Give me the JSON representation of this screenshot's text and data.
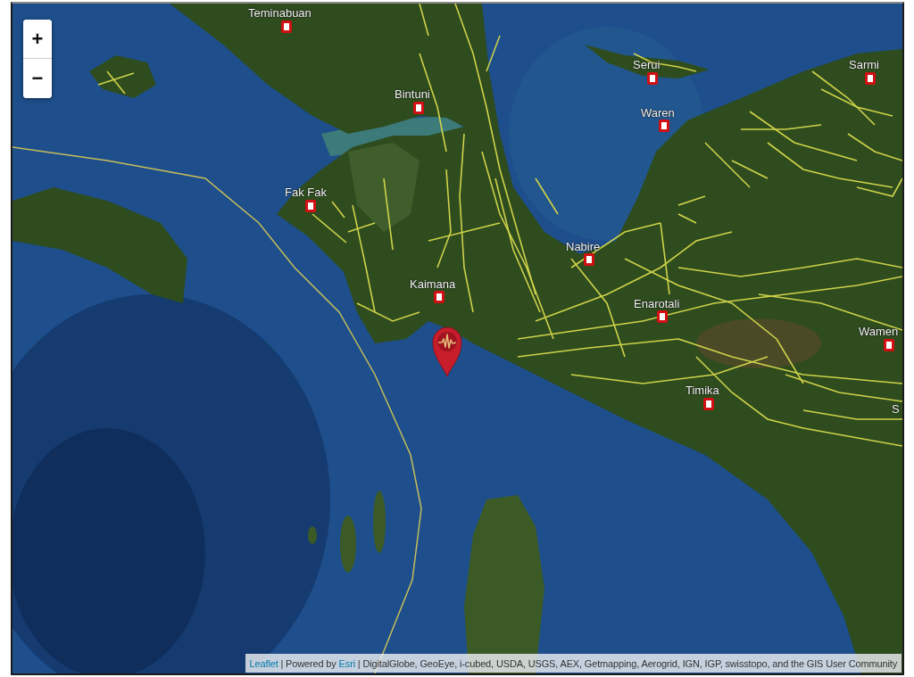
{
  "map": {
    "zoom_control": {
      "zoom_in": "+",
      "zoom_out": "−"
    },
    "cities": [
      {
        "name": "Teminabuan"
      },
      {
        "name": "Serui"
      },
      {
        "name": "Sarmi"
      },
      {
        "name": "Bintuni"
      },
      {
        "name": "Waren"
      },
      {
        "name": "Fak Fak"
      },
      {
        "name": "Nabire"
      },
      {
        "name": "Kaimana"
      },
      {
        "name": "Enarotali"
      },
      {
        "name": "Wamen"
      },
      {
        "name": "Timika"
      },
      {
        "name": "S"
      }
    ],
    "attribution": [
      {
        "kind": "link",
        "text": "Leaflet"
      },
      {
        "kind": "text",
        "text": "| Powered by"
      },
      {
        "kind": "link",
        "text": "Esri"
      },
      {
        "kind": "text",
        "text": "| DigitalGlobe, GeoEye, i-cubed, USDA, USGS, AEX, Getmapping, Aerogrid, IGN, IGP, swisstopo, and the GIS User Community"
      }
    ]
  }
}
